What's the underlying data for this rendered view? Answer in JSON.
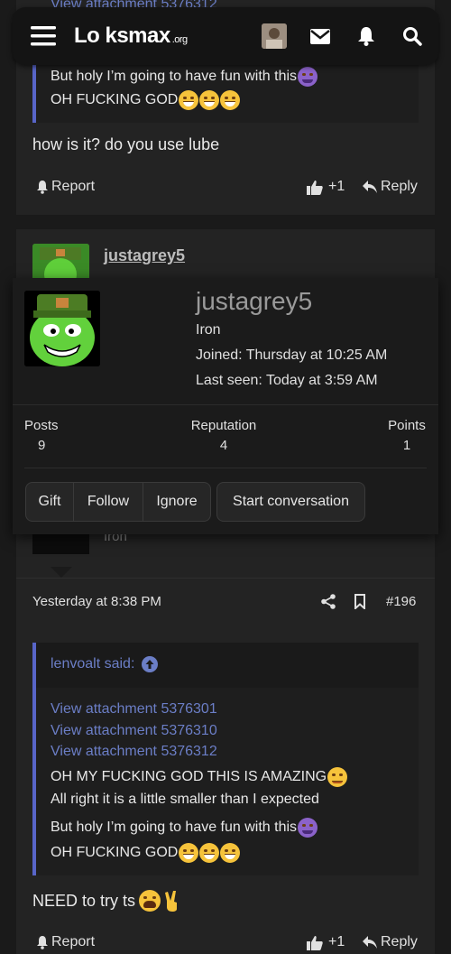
{
  "header": {
    "site_name": "Lo ksmax",
    "site_suffix": ".org",
    "icons": [
      "menu-icon",
      "avatar",
      "mail-icon",
      "bell-icon",
      "search-icon"
    ]
  },
  "peek_text": "View attachment 5376312",
  "post1": {
    "quote_lines": [
      "But holy I’m going to have fun with this",
      "OH FUCKING GOD"
    ],
    "body": "how is it? do you use lube",
    "report_label": "Report",
    "like_count": "+1",
    "reply_label": "Reply"
  },
  "user_post": {
    "username": "justagrey5",
    "rank": "Iron",
    "timestamp": "Yesterday at 8:38 PM",
    "post_number": "#196"
  },
  "popup": {
    "username": "justagrey5",
    "rank": "Iron",
    "joined": "Joined: Thursday at 10:25 AM",
    "last_seen": "Last seen: Today at 3:59 AM",
    "stats": [
      {
        "label": "Posts",
        "value": "9"
      },
      {
        "label": "Reputation",
        "value": "4"
      },
      {
        "label": "Points",
        "value": "1"
      }
    ],
    "buttons": [
      "Gift",
      "Follow",
      "Ignore",
      "Start conversation"
    ]
  },
  "post2": {
    "quote_author": "lenvoalt said:",
    "attachments": [
      "View attachment 5376301",
      "View attachment 5376310",
      "View attachment 5376312"
    ],
    "quote_lines": [
      "OH MY FUCKING GOD THIS IS AMAZING",
      "All right it is a little smaller than I expected",
      "But holy I’m going to have fun with this",
      "OH FUCKING GOD"
    ],
    "body": "NEED to try ts",
    "report_label": "Report",
    "like_count": "+1",
    "reply_label": "Reply"
  },
  "colors": {
    "accent": "#5865c8",
    "link": "#6b7ec6",
    "card": "#232323",
    "background": "#1a1a1a"
  }
}
